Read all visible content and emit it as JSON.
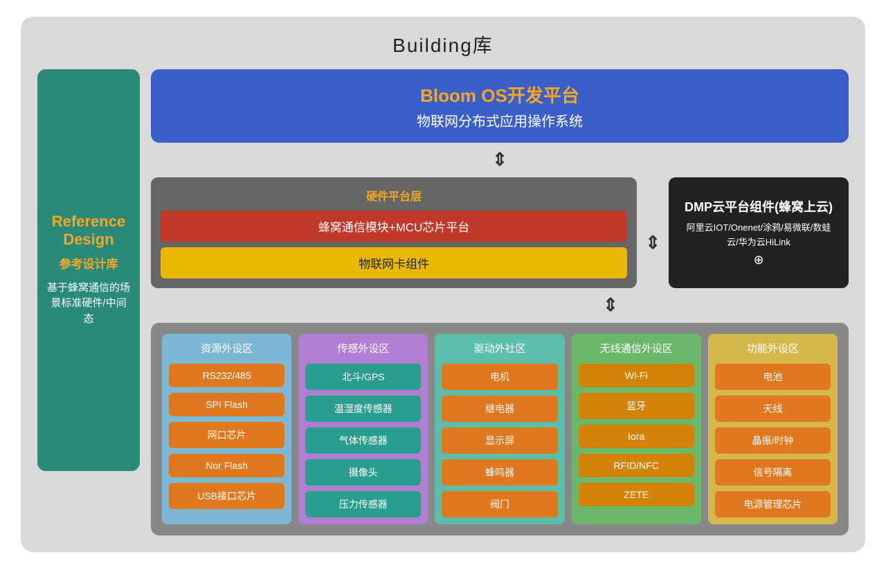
{
  "page": {
    "title": "Building库"
  },
  "sidebar": {
    "reference": "Reference",
    "design": "Design",
    "subtitle_cn": "参考设计库",
    "description": "基于蜂窝通信的场景标准硬件/中间态"
  },
  "bloom_os": {
    "title": "Bloom OS开发平台",
    "subtitle": "物联网分布式应用操作系统"
  },
  "hardware": {
    "title": "硬件平台层",
    "row1": "蜂窝通信模块+MCU芯片平台",
    "row2": "物联网卡组件"
  },
  "dmp": {
    "title": "DMP云平台组件(蜂窝上云)",
    "subtitle": "阿里云IOT/Onenet/涂鸦/易微联/数蛙云/华为云HiLink",
    "plus": "⊕"
  },
  "peripherals": {
    "resource": {
      "header": "资源外设区",
      "items": [
        "RS232/485",
        "SPI Flash",
        "网口芯片",
        "Nor Flash",
        "USB接口芯片"
      ]
    },
    "sensor": {
      "header": "传感外设区",
      "items": [
        "北斗/GPS",
        "温湿度传感器",
        "气体传感器",
        "摄像头",
        "压力传感器"
      ]
    },
    "drive": {
      "header": "驱动外社区",
      "items": [
        "电机",
        "继电器",
        "显示屏",
        "蜂鸣器",
        "阀门"
      ]
    },
    "wireless": {
      "header": "无线通信外设区",
      "items": [
        "Wi-Fi",
        "蓝牙",
        "Iora",
        "RFID/NFC",
        "ZETE"
      ]
    },
    "function": {
      "header": "功能外设区",
      "items": [
        "电池",
        "天线",
        "晶振/时钟",
        "信号隔离",
        "电源管理芯片"
      ]
    }
  }
}
